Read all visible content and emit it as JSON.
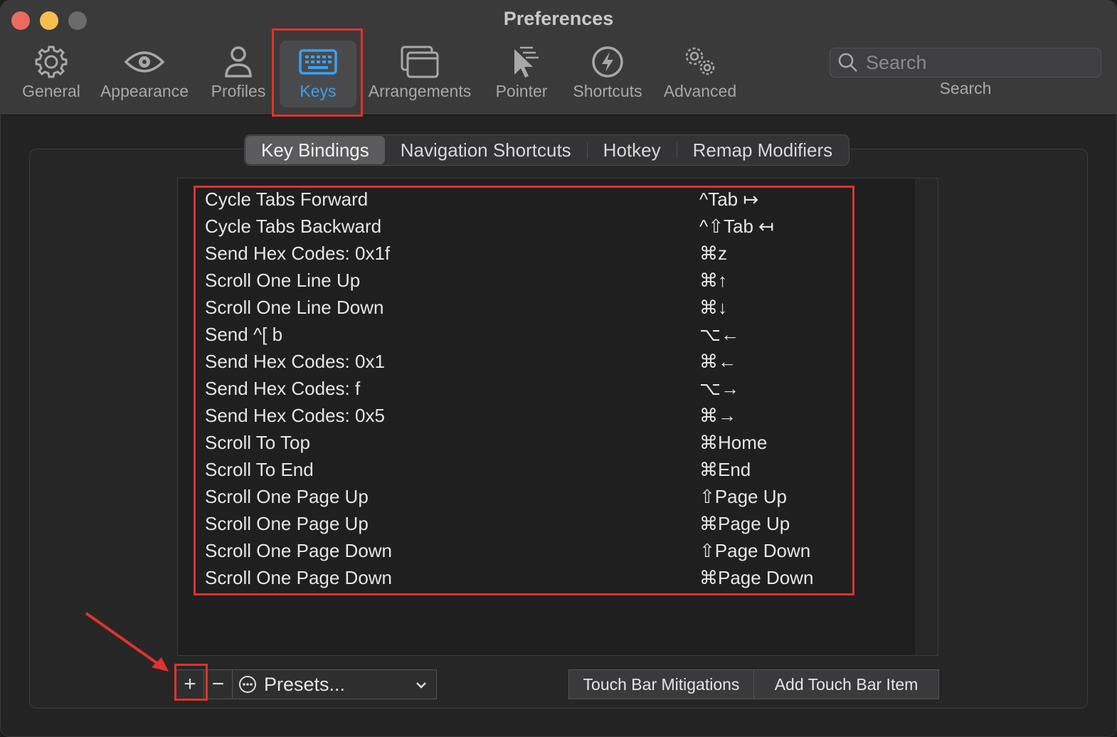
{
  "window": {
    "title": "Preferences"
  },
  "toolbar": {
    "items": [
      {
        "label": "General",
        "icon": "gear-icon"
      },
      {
        "label": "Appearance",
        "icon": "eye-icon"
      },
      {
        "label": "Profiles",
        "icon": "person-icon"
      },
      {
        "label": "Keys",
        "icon": "keyboard-icon",
        "active": true
      },
      {
        "label": "Arrangements",
        "icon": "windows-icon"
      },
      {
        "label": "Pointer",
        "icon": "pointer-icon"
      },
      {
        "label": "Shortcuts",
        "icon": "lightning-icon"
      },
      {
        "label": "Advanced",
        "icon": "gears-icon"
      }
    ],
    "search": {
      "placeholder": "Search",
      "label": "Search"
    }
  },
  "tabs": {
    "items": [
      "Key Bindings",
      "Navigation Shortcuts",
      "Hotkey",
      "Remap Modifiers"
    ],
    "selected": "Key Bindings"
  },
  "bindings": [
    {
      "action": "Cycle Tabs Forward",
      "keys": "^Tab ↦"
    },
    {
      "action": "Cycle Tabs Backward",
      "keys": "^⇧Tab ↤"
    },
    {
      "action": "Send Hex Codes: 0x1f",
      "keys": "⌘z"
    },
    {
      "action": "Scroll One Line Up",
      "keys": "⌘↑"
    },
    {
      "action": "Scroll One Line Down",
      "keys": "⌘↓"
    },
    {
      "action": "Send ^[ b",
      "keys": "⌥←"
    },
    {
      "action": "Send Hex Codes: 0x1",
      "keys": "⌘←"
    },
    {
      "action": "Send Hex Codes: f",
      "keys": "⌥→"
    },
    {
      "action": "Send Hex Codes: 0x5",
      "keys": "⌘→"
    },
    {
      "action": "Scroll To Top",
      "keys": "⌘Home"
    },
    {
      "action": "Scroll To End",
      "keys": "⌘End"
    },
    {
      "action": "Scroll One Page Up",
      "keys": "⇧Page Up"
    },
    {
      "action": "Scroll One Page Up",
      "keys": "⌘Page Up"
    },
    {
      "action": "Scroll One Page Down",
      "keys": "⇧Page Down"
    },
    {
      "action": "Scroll One Page Down",
      "keys": "⌘Page Down"
    }
  ],
  "bottom": {
    "add_label": "+",
    "remove_label": "−",
    "presets_label": "Presets...",
    "touch_bar_mitigations": "Touch Bar Mitigations",
    "add_touch_bar_item": "Add Touch Bar Item"
  },
  "colors": {
    "accent": "#3aa0f3",
    "annotation_red": "#e0322d"
  }
}
